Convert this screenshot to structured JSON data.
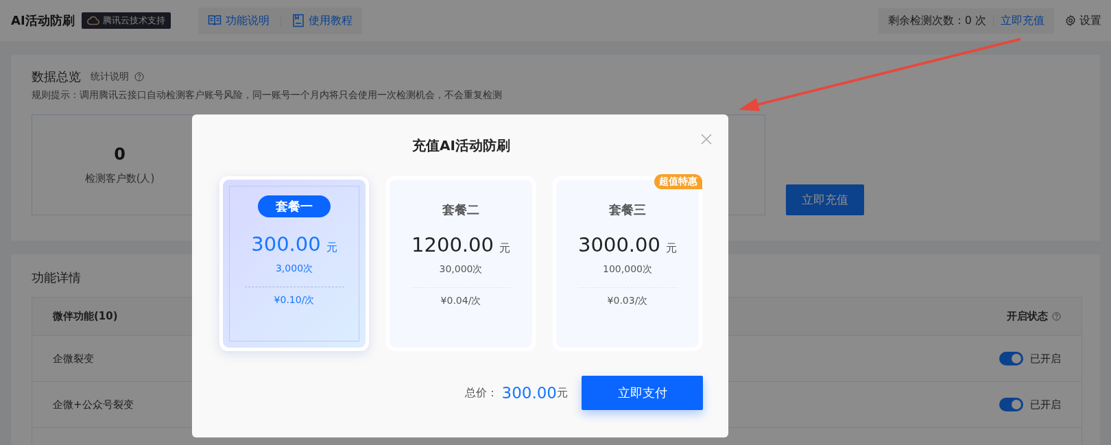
{
  "header": {
    "title": "AI活动防刷",
    "badge": "腾讯云技术支持",
    "nav_links": [
      {
        "label": "功能说明",
        "kind": "book"
      },
      {
        "label": "使用教程",
        "kind": "doc"
      }
    ],
    "remaining": "剩余检测次数：0 次",
    "recharge_link": "立即充值",
    "settings": "设置"
  },
  "overview": {
    "title": "数据总览",
    "help": "统计说明",
    "rule": "规则提示：调用腾讯云接口自动检测客户账号风险，同一账号一个月内将只会使用一次检测机会，不会重复检测",
    "stats": [
      {
        "value": "0",
        "label": "检测客户数(人)"
      }
    ],
    "button": "立即充值"
  },
  "features": {
    "title": "功能详情",
    "columns": [
      "微伴功能(10)",
      "开启状态"
    ],
    "rows": [
      {
        "name": "企微裂变",
        "on": true,
        "status": "已开启"
      },
      {
        "name": "企微+公众号裂变",
        "on": true,
        "status": "已开启"
      }
    ]
  },
  "modal": {
    "title": "充值AI活动防刷",
    "plans": [
      {
        "name": "套餐一",
        "price": "300.00",
        "unit": "元",
        "count": "3,000次",
        "unit_price": "¥0.10/次",
        "selected": true
      },
      {
        "name": "套餐二",
        "price": "1200.00",
        "unit": "元",
        "count": "30,000次",
        "unit_price": "¥0.04/次",
        "selected": false
      },
      {
        "name": "套餐三",
        "price": "3000.00",
        "unit": "元",
        "count": "100,000次",
        "unit_price": "¥0.03/次",
        "selected": false,
        "badge": "超值特惠"
      }
    ],
    "total_label": "总价：",
    "total": "300.00",
    "total_unit": "元",
    "pay_button": "立即支付"
  }
}
